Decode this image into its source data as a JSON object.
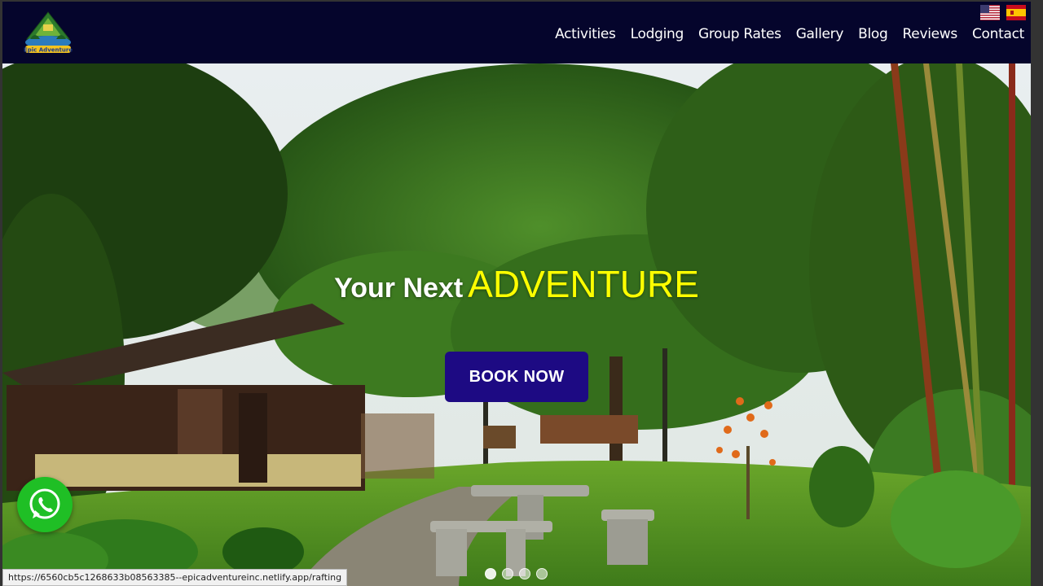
{
  "header": {
    "logo_text": "Epic Adventure",
    "nav": [
      "Activities",
      "Lodging",
      "Group Rates",
      "Gallery",
      "Blog",
      "Reviews",
      "Contact"
    ],
    "flags": [
      "us-flag-icon",
      "es-flag-icon"
    ]
  },
  "hero": {
    "title_pre": "Your Next",
    "title_em": "ADVENTURE",
    "cta": "BOOK NOW",
    "slides_total": 4,
    "active_slide": 1
  },
  "status_bar": {
    "url": "https://6560cb5c1268633b08563385--epicadventureinc.netlify.app/rafting"
  },
  "colors": {
    "header_bg": "#05052c",
    "cta_bg": "#1d0a83",
    "accent_yellow": "#ffff00",
    "whatsapp_green": "#1fbf25"
  }
}
